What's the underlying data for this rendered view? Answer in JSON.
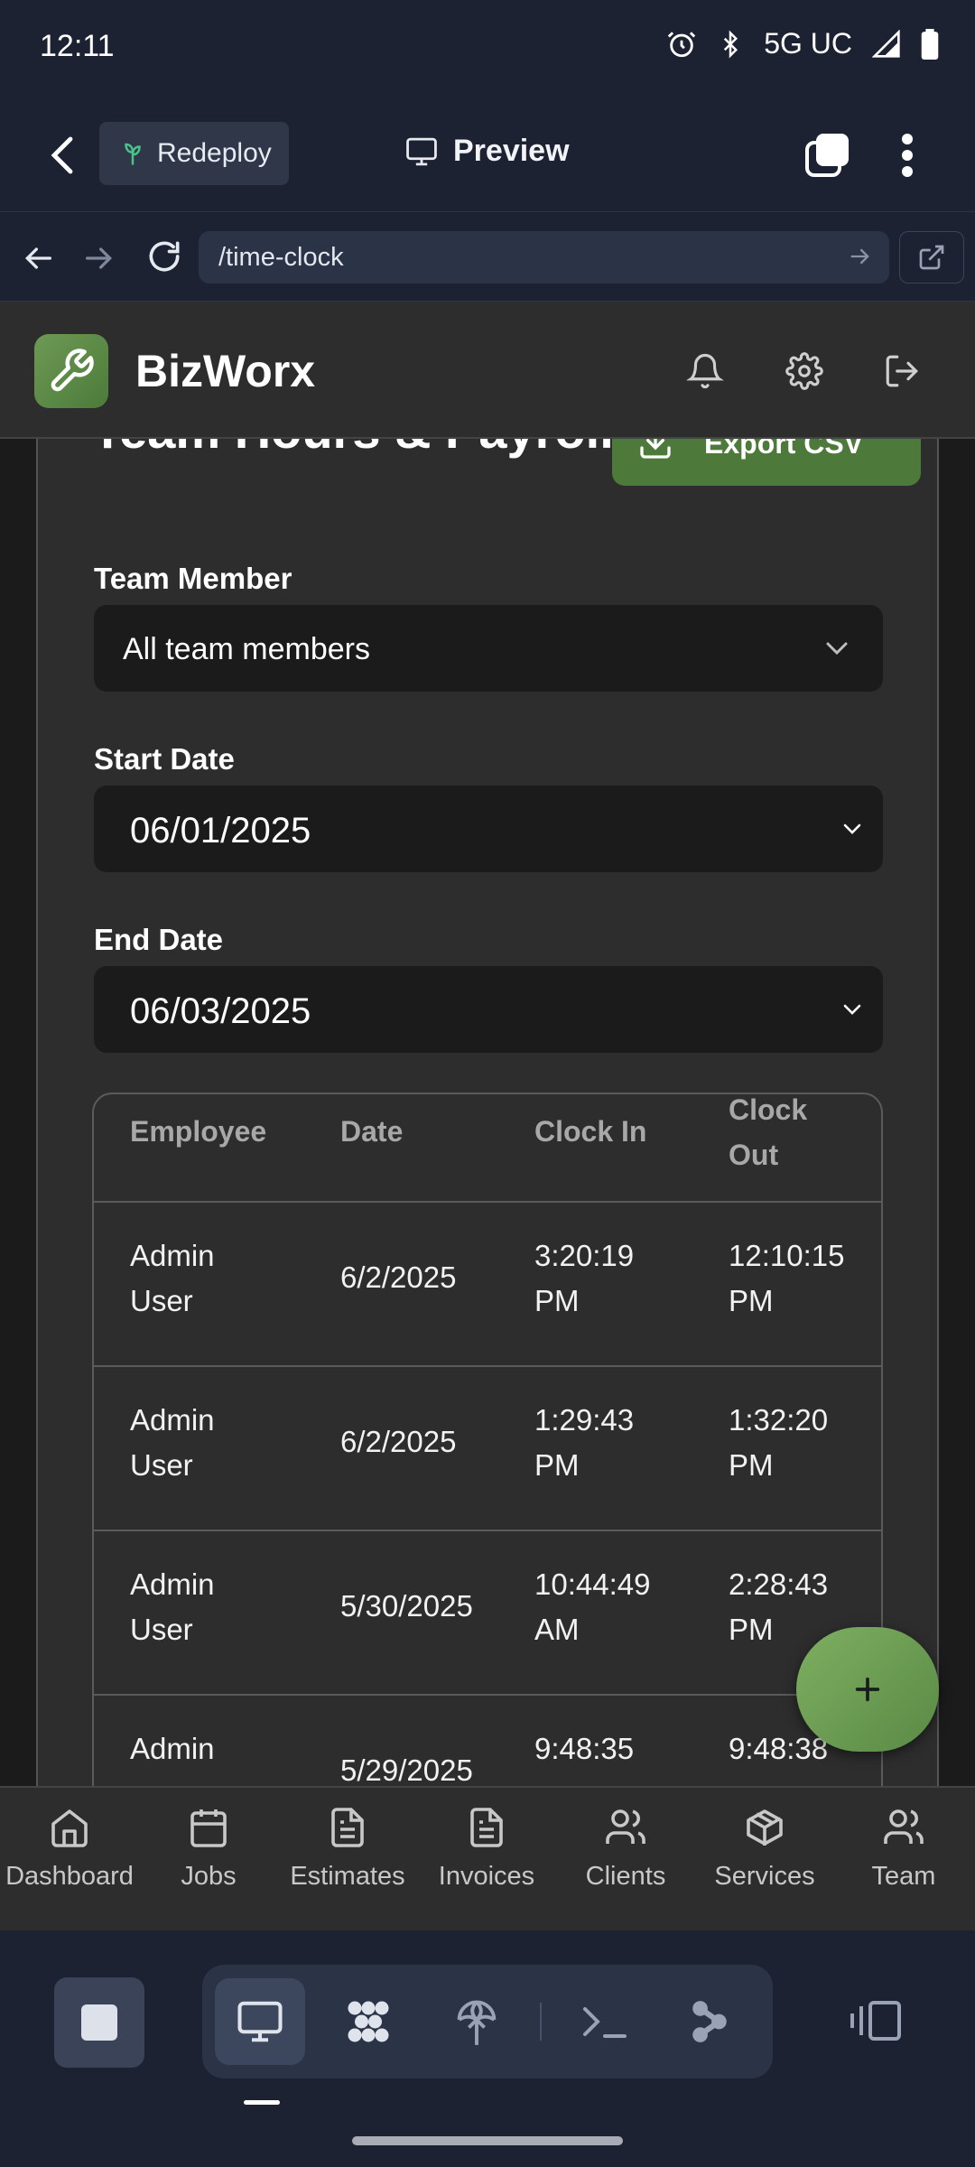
{
  "status_bar": {
    "time": "12:11",
    "network": "5G UC"
  },
  "app_bar": {
    "redeploy_label": "Redeploy",
    "preview_label": "Preview"
  },
  "url_bar": {
    "url": "/time-clock"
  },
  "site": {
    "brand": "BizWorx",
    "card_title": "Team Hours & Payroll",
    "export_label": "Export CSV",
    "filters": {
      "member_label": "Team Member",
      "member_value": "All team members",
      "start_label": "Start Date",
      "start_value": "06/01/2025",
      "end_label": "End Date",
      "end_value": "06/03/2025"
    },
    "table": {
      "headers": [
        "Employee",
        "Date",
        "Clock In",
        "Clock\nOut"
      ],
      "rows": [
        [
          "Admin\nUser",
          "6/2/2025",
          "3:20:19\nPM",
          "12:10:15\nPM"
        ],
        [
          "Admin\nUser",
          "6/2/2025",
          "1:29:43\nPM",
          "1:32:20\nPM"
        ],
        [
          "Admin\nUser",
          "5/30/2025",
          "10:44:49\nAM",
          "2:28:43\nPM"
        ],
        [
          "Admin",
          "5/29/2025",
          "9:48:35",
          "9:48:38"
        ]
      ]
    },
    "fab_label": "+",
    "bottom_nav": [
      "Dashboard",
      "Jobs",
      "Estimates",
      "Invoices",
      "Clients",
      "Services",
      "Team"
    ]
  },
  "colors": {
    "accent_green": "#4d7a3a",
    "fab_green": "#7daf61",
    "page_bg": "#1b1b1b",
    "panel_bg": "#2d2d2d",
    "chrome_bg": "#1c2231"
  },
  "icons": [
    "alarm-icon",
    "bluetooth-icon",
    "signal-icon",
    "battery-icon",
    "back-arrow-icon",
    "sprout-icon",
    "monitor-icon",
    "tabs-icon",
    "more-vert-icon",
    "refresh-icon",
    "external-link-icon",
    "wrench-icon",
    "bell-icon",
    "gear-icon",
    "logout-icon",
    "download-icon",
    "chevron-down-icon",
    "home-icon",
    "calendar-icon",
    "file-text-icon",
    "users-icon",
    "package-icon",
    "plus-icon",
    "stop-icon",
    "terminal-icon",
    "sidebar-icon"
  ]
}
